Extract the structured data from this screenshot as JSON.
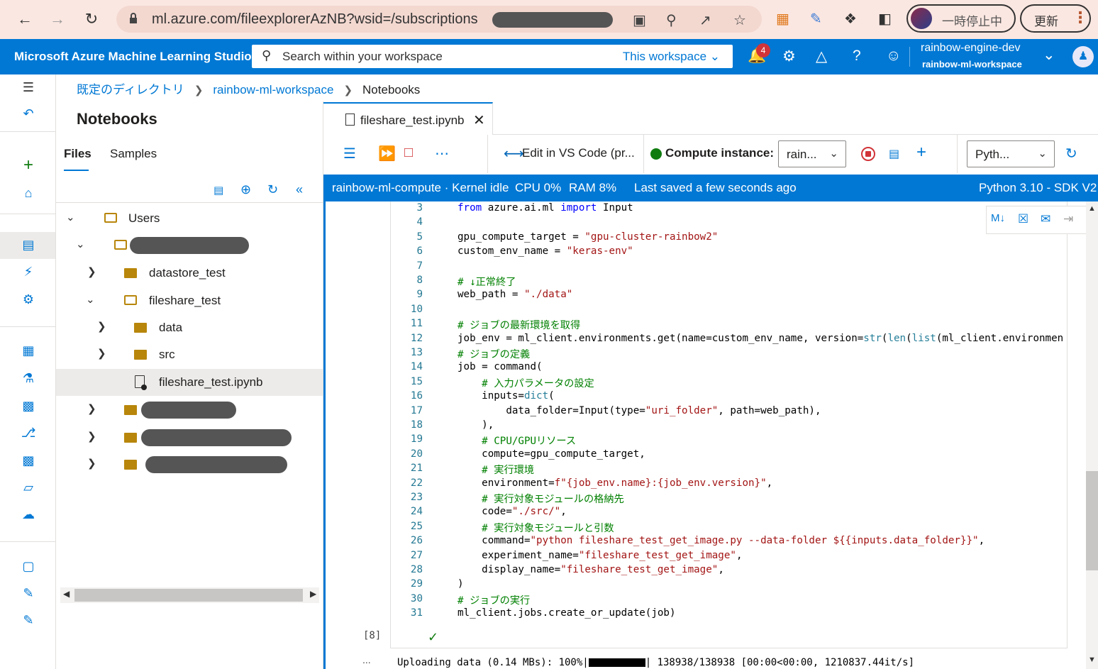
{
  "browser": {
    "url_visible": "ml.azure.com/fileexplorerAzNB?wsid=/subscriptions",
    "url_ellipsis": "...",
    "profile_status": "一時停止中",
    "update_label": "更新",
    "back_icon": "arrow-left-icon",
    "forward_icon": "arrow-right-icon",
    "reload_icon": "reload-icon"
  },
  "azure": {
    "brand": "Microsoft Azure Machine Learning Studio",
    "search_placeholder": "Search within your workspace",
    "search_scope": "This workspace",
    "notification_count": "4",
    "account_name": "rainbow-engine-dev",
    "workspace_name": "rainbow-ml-workspace"
  },
  "breadcrumb": {
    "items": [
      "既定のディレクトリ",
      "rainbow-ml-workspace"
    ],
    "current": "Notebooks"
  },
  "file_panel": {
    "title": "Notebooks",
    "tabs": [
      "Files",
      "Samples"
    ],
    "active_tab": "Files",
    "tree": {
      "users": "Users",
      "datastore_test": "datastore_test",
      "fileshare_test": "fileshare_test",
      "data": "data",
      "src": "src",
      "notebook": "fileshare_test.ipynb"
    }
  },
  "editor": {
    "tab_label": "fileshare_test.ipynb",
    "vscode_label": "Edit in VS Code (pr...",
    "compute_label": "Compute instance:",
    "compute_value": "rain...",
    "kernel_value": "Pyth...",
    "status": {
      "compute": "rainbow-ml-compute · Kernel idle",
      "cpu": "CPU  0%",
      "ram": "RAM  8%",
      "saved": "Last saved a few seconds ago",
      "runtime": "Python 3.10 - SDK V2"
    },
    "exec_count": "[8]",
    "output_line_prefix": "Uploading data (0.14 MBs): 100%|",
    "output_line_suffix": "| 138938/138938 [00:00<00:00, 1210837.44it/s]",
    "output_dots": "..."
  },
  "code_lines": [
    {
      "n": "3",
      "t": "from azure.ai.ml import Input"
    },
    {
      "n": "4",
      "t": ""
    },
    {
      "n": "5",
      "t": "gpu_compute_target = \"gpu-cluster-rainbow2\""
    },
    {
      "n": "6",
      "t": "custom_env_name = \"keras-env\""
    },
    {
      "n": "7",
      "t": ""
    },
    {
      "n": "8",
      "t": "# ↓正常終了"
    },
    {
      "n": "9",
      "t": "web_path = \"./data\""
    },
    {
      "n": "10",
      "t": ""
    },
    {
      "n": "11",
      "t": "# ジョブの最新環境を取得"
    },
    {
      "n": "12",
      "t": "job_env = ml_client.environments.get(name=custom_env_name, version=str(len(list(ml_client.environmen"
    },
    {
      "n": "13",
      "t": "# ジョブの定義"
    },
    {
      "n": "14",
      "t": "job = command("
    },
    {
      "n": "15",
      "t": "    # 入力パラメータの設定"
    },
    {
      "n": "16",
      "t": "    inputs=dict("
    },
    {
      "n": "17",
      "t": "        data_folder=Input(type=\"uri_folder\", path=web_path),"
    },
    {
      "n": "18",
      "t": "    ),"
    },
    {
      "n": "19",
      "t": "    # CPU/GPUリソース"
    },
    {
      "n": "20",
      "t": "    compute=gpu_compute_target,"
    },
    {
      "n": "21",
      "t": "    # 実行環境"
    },
    {
      "n": "22",
      "t": "    environment=f\"{job_env.name}:{job_env.version}\","
    },
    {
      "n": "23",
      "t": "    # 実行対象モジュールの格納先"
    },
    {
      "n": "24",
      "t": "    code=\"./src/\","
    },
    {
      "n": "25",
      "t": "    # 実行対象モジュールと引数"
    },
    {
      "n": "26",
      "t": "    command=\"python fileshare_test_get_image.py --data-folder ${{inputs.data_folder}}\","
    },
    {
      "n": "27",
      "t": "    experiment_name=\"fileshare_test_get_image\","
    },
    {
      "n": "28",
      "t": "    display_name=\"fileshare_test_get_image\","
    },
    {
      "n": "29",
      "t": ")"
    },
    {
      "n": "30",
      "t": "# ジョブの実行"
    },
    {
      "n": "31",
      "t": "ml_client.jobs.create_or_update(job)"
    }
  ],
  "colors": {
    "azure_blue": "#0078d4",
    "chrome_bg": "#fbe7e1",
    "running_green": "#107c10",
    "stop_red": "#d13438"
  }
}
